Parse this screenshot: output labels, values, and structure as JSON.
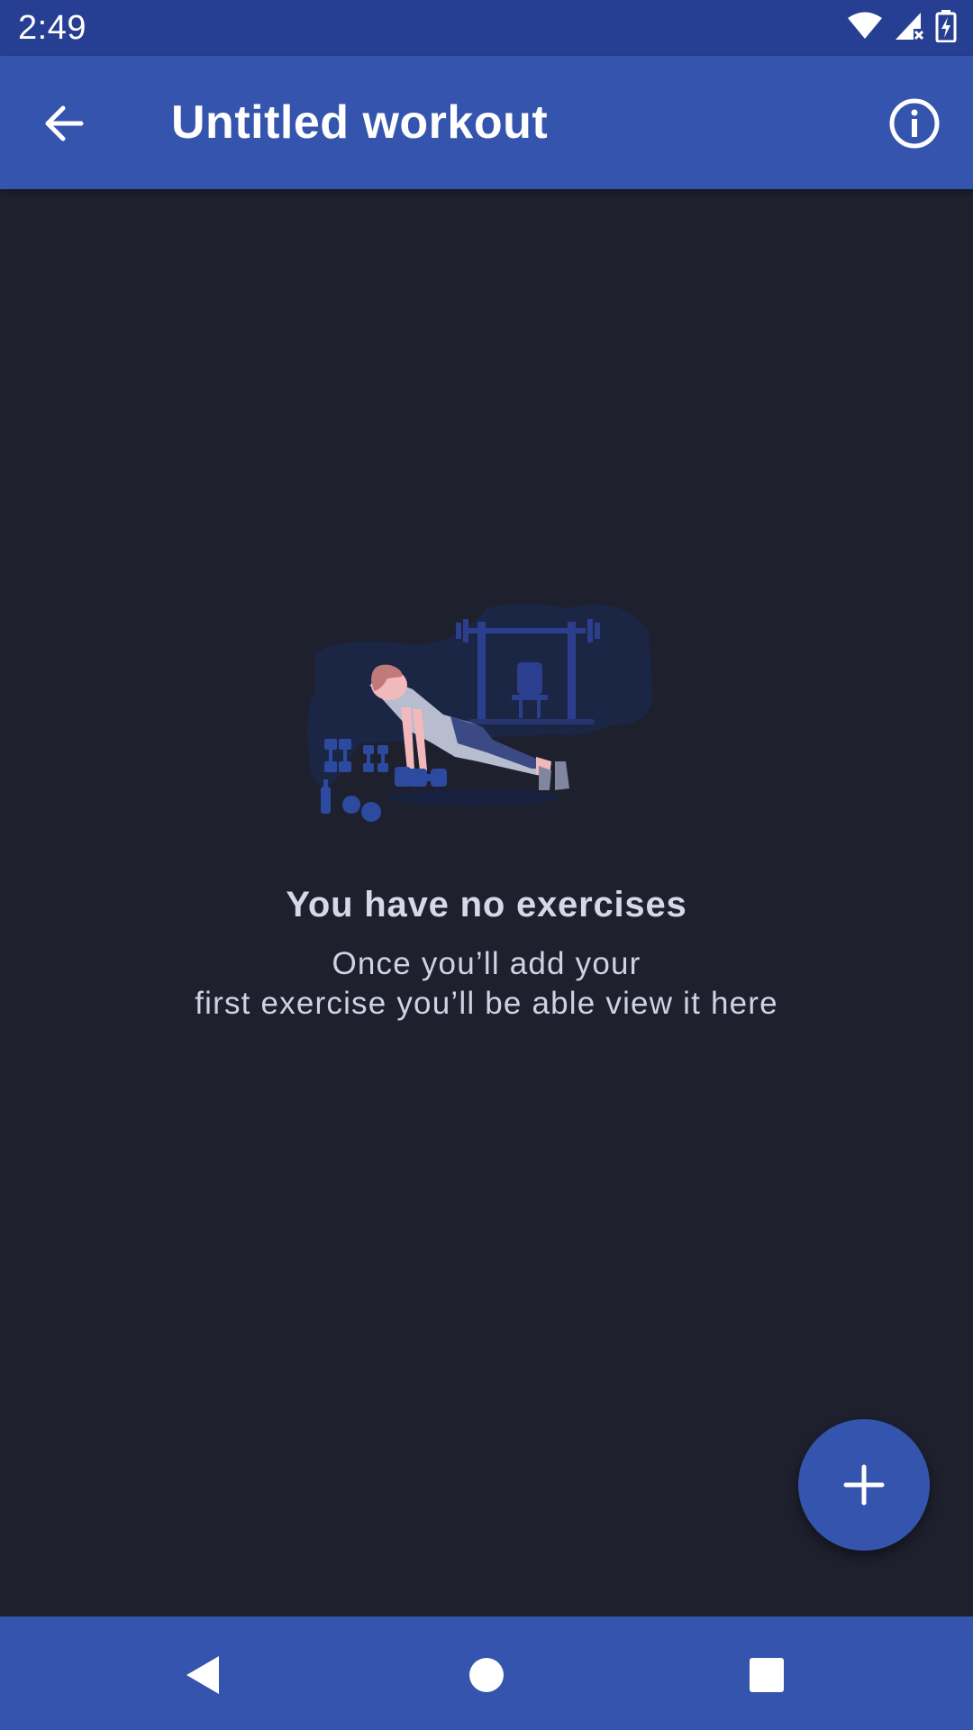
{
  "status_bar": {
    "time": "2:49",
    "icons": [
      "wifi-icon",
      "cell-signal-icon",
      "battery-charging-icon"
    ]
  },
  "app_bar": {
    "title": "Untitled workout",
    "back_icon": "arrow-back-icon",
    "info_icon": "info-icon",
    "background": "#3554ad"
  },
  "empty_state": {
    "illustration": "workout-pushup-illustration",
    "title": "You have no exercises",
    "description_line1": "Once you’ll add your",
    "description_line2": "first exercise you’ll be able view it here"
  },
  "fab": {
    "icon": "plus-icon",
    "color": "#3554ad"
  },
  "nav_bar": {
    "icons": [
      "nav-back-icon",
      "nav-home-icon",
      "nav-recents-icon"
    ]
  },
  "colors": {
    "background": "#1e202e",
    "status_bar": "#273f93",
    "accent": "#3554ad"
  }
}
